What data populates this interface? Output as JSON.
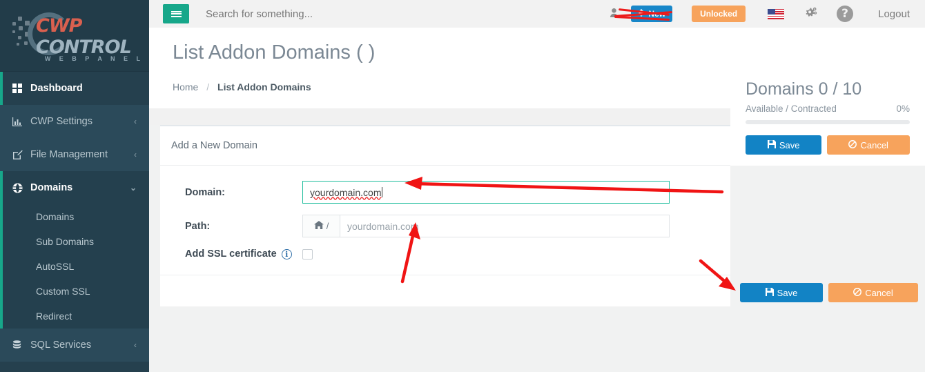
{
  "brand": {
    "logo_primary": "CWP",
    "logo_secondary": "CONTROL",
    "logo_tagline": "W E B   P A N E L",
    "accent_color": "#17a78a",
    "sidebar_color": "#25404e"
  },
  "topbar": {
    "menu_toggle_icon": "hamburger-icon",
    "search": {
      "value": "",
      "placeholder": "Search for something..."
    },
    "user": {
      "icon": "user-icon",
      "name": "",
      "redacted": true
    },
    "new_badge": {
      "label": "New",
      "icon": "bell-icon",
      "color": "#1887c9"
    },
    "unlocked_badge": {
      "label": "Unlocked",
      "color": "#f7a35c"
    },
    "language_flag": "us-flag-icon",
    "settings_icon": "cogs-icon",
    "help_icon": "question-circle-icon",
    "logout_label": "Logout"
  },
  "sidebar": {
    "items": [
      {
        "label": "Dashboard",
        "icon": "grid-icon",
        "state": "active-top",
        "chevron": ""
      },
      {
        "label": "CWP Settings",
        "icon": "bar-chart-icon",
        "state": "normal",
        "chevron": "‹"
      },
      {
        "label": "File Management",
        "icon": "edit-icon",
        "state": "normal",
        "chevron": "‹"
      },
      {
        "label": "Domains",
        "icon": "globe-icon",
        "state": "open",
        "chevron": "⌄"
      },
      {
        "label": "SQL Services",
        "icon": "database-icon",
        "state": "normal",
        "chevron": "‹"
      }
    ],
    "domains_subitems": [
      {
        "label": "Domains"
      },
      {
        "label": "Sub Domains"
      },
      {
        "label": "AutoSSL"
      },
      {
        "label": "Custom SSL"
      },
      {
        "label": "Redirect"
      }
    ]
  },
  "page": {
    "title": "List Addon Domains ( )",
    "breadcrumb": {
      "home": "Home",
      "separator": "/",
      "current": "List Addon Domains"
    }
  },
  "widget": {
    "title": "Domains 0 / 10",
    "subtitle": "Available / Contracted",
    "percent_label": "0%",
    "progress_value": 0,
    "save_label": "Save",
    "save_icon": "floppy-icon",
    "cancel_label": "Cancel",
    "cancel_icon": "ban-icon"
  },
  "form": {
    "panel_title": "Add a New Domain",
    "domain": {
      "label": "Domain:",
      "value": "yourdomain.com",
      "placeholder": "",
      "focused": true,
      "spellcheck_error": true
    },
    "path": {
      "label": "Path:",
      "addon_icon": "home-icon",
      "addon_text": "/",
      "value": "",
      "placeholder": "yourdomain.com"
    },
    "ssl": {
      "label": "Add SSL certificate",
      "info_icon": "info-circle-icon",
      "info_glyph": "i",
      "checked": false
    },
    "save_label": "Save",
    "save_icon": "floppy-icon",
    "cancel_label": "Cancel",
    "cancel_icon": "ban-icon"
  },
  "annotations": {
    "color": "#f01414",
    "marks": [
      {
        "name": "arrow-to-domain-input",
        "type": "arrow"
      },
      {
        "name": "arrow-to-path-input",
        "type": "arrow"
      },
      {
        "name": "arrow-to-save-button",
        "type": "arrow"
      },
      {
        "name": "username-redaction",
        "type": "scribble"
      }
    ]
  }
}
